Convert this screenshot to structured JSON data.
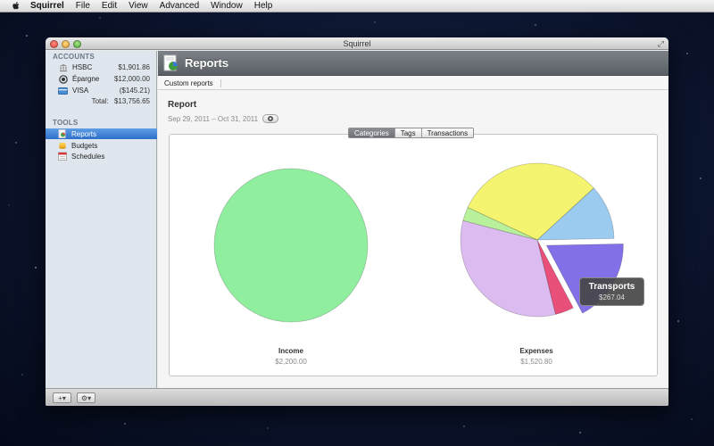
{
  "menubar": {
    "app_name": "Squirrel",
    "items": [
      "File",
      "Edit",
      "View",
      "Advanced",
      "Window",
      "Help"
    ]
  },
  "window": {
    "title": "Squirrel"
  },
  "sidebar": {
    "accounts_header": "ACCOUNTS",
    "accounts": [
      {
        "name": "HSBC",
        "amount": "$1,901.86",
        "icon": "bank-icon"
      },
      {
        "name": "Épargne",
        "amount": "$12,000.00",
        "icon": "savings-icon"
      },
      {
        "name": "VISA",
        "amount": "($145.21)",
        "icon": "credit-card-icon"
      }
    ],
    "total_label": "Total:",
    "total_amount": "$13,756.65",
    "tools_header": "TOOLS",
    "tools": [
      {
        "name": "Reports",
        "icon": "reports-icon",
        "selected": true
      },
      {
        "name": "Budgets",
        "icon": "budgets-icon",
        "selected": false
      },
      {
        "name": "Schedules",
        "icon": "schedules-icon",
        "selected": false
      }
    ]
  },
  "bottombar": {
    "add_label": "+▾",
    "settings_label": "⚙▾"
  },
  "header": {
    "title": "Reports"
  },
  "subtabs": [
    "Custom reports"
  ],
  "report": {
    "title": "Report",
    "date_range": "Sep 29, 2011 – Oct 31, 2011"
  },
  "segmented": {
    "items": [
      "Categories",
      "Tags",
      "Transactions"
    ],
    "active": "Categories"
  },
  "colors": {
    "income": "#90ee9f",
    "expenses_yellow": "#f4f470",
    "expenses_blue": "#9ccbf0",
    "expenses_purple": "#8270e8",
    "expenses_red": "#e8507a",
    "expenses_lavender": "#dcbcf0",
    "expenses_green": "#b8f09c",
    "selection": "#2d6fc9"
  },
  "chart_data": [
    {
      "type": "pie",
      "title": "Income",
      "total": "$2,200.00",
      "slices": [
        {
          "name": "",
          "value": 2200.0,
          "color": "#90ee9f"
        }
      ]
    },
    {
      "type": "pie",
      "title": "Expenses",
      "total": "$1,520.80",
      "slices": [
        {
          "name": "",
          "value": 475,
          "color": "#f4f470"
        },
        {
          "name": "",
          "value": 175,
          "color": "#9ccbf0"
        },
        {
          "name": "Transports",
          "value": 267.04,
          "color": "#8270e8",
          "exploded": true
        },
        {
          "name": "",
          "value": 60,
          "color": "#e8507a"
        },
        {
          "name": "",
          "value": 500,
          "color": "#dcbcf0"
        },
        {
          "name": "",
          "value": 43.76,
          "color": "#b8f09c"
        }
      ]
    }
  ],
  "tooltip": {
    "name": "Transports",
    "value": "$267.04"
  }
}
